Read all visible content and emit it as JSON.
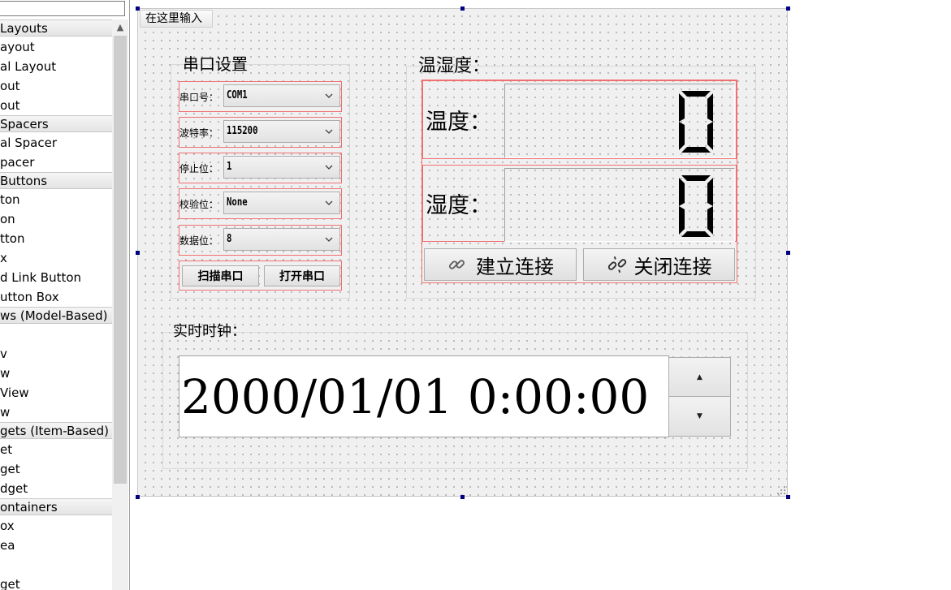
{
  "widget_box": {
    "filter_value": "",
    "rows": [
      {
        "kind": "cat",
        "text": "Layouts",
        "indent": 0
      },
      {
        "kind": "item",
        "text": "ayout",
        "indent": 0
      },
      {
        "kind": "item",
        "text": "al Layout",
        "indent": 0
      },
      {
        "kind": "item",
        "text": "out",
        "indent": 0
      },
      {
        "kind": "item",
        "text": "out",
        "indent": 0
      },
      {
        "kind": "cat",
        "text": "Spacers",
        "indent": 0
      },
      {
        "kind": "item",
        "text": "al Spacer",
        "indent": 0
      },
      {
        "kind": "item",
        "text": "pacer",
        "indent": 0
      },
      {
        "kind": "cat",
        "text": "Buttons",
        "indent": 0
      },
      {
        "kind": "item",
        "text": "ton",
        "indent": 0
      },
      {
        "kind": "item",
        "text": "on",
        "indent": 0
      },
      {
        "kind": "item",
        "text": "tton",
        "indent": 0
      },
      {
        "kind": "item",
        "text": "x",
        "indent": 0
      },
      {
        "kind": "item",
        "text": "d Link Button",
        "indent": 0
      },
      {
        "kind": "item",
        "text": "utton Box",
        "indent": 0
      },
      {
        "kind": "cat",
        "text": "ws (Model-Based)",
        "indent": 0
      },
      {
        "kind": "item",
        "text": "",
        "indent": 0
      },
      {
        "kind": "item",
        "text": "v",
        "indent": 0
      },
      {
        "kind": "item",
        "text": "w",
        "indent": 0
      },
      {
        "kind": "item",
        "text": "View",
        "indent": 0
      },
      {
        "kind": "item",
        "text": "w",
        "indent": 0
      },
      {
        "kind": "cat",
        "text": "gets (Item-Based)",
        "indent": 0
      },
      {
        "kind": "item",
        "text": "et",
        "indent": 0
      },
      {
        "kind": "item",
        "text": "get",
        "indent": 0
      },
      {
        "kind": "item",
        "text": "dget",
        "indent": 0
      },
      {
        "kind": "cat",
        "text": "ontainers",
        "indent": 0
      },
      {
        "kind": "item",
        "text": "ox",
        "indent": 0
      },
      {
        "kind": "item",
        "text": "ea",
        "indent": 0
      },
      {
        "kind": "item",
        "text": "",
        "indent": 0
      },
      {
        "kind": "item",
        "text": "get",
        "indent": 0
      }
    ]
  },
  "form": {
    "menu_placeholder": "在这里输入",
    "serial": {
      "title": "串口设置",
      "port_label": "串口号：",
      "port_value": "COM1",
      "baud_label": "波特率：",
      "baud_value": "115200",
      "stop_label": "停止位：",
      "stop_value": "1",
      "parity_label": "校验位：",
      "parity_value": "None",
      "data_label": "数据位：",
      "data_value": "8",
      "scan_button": "扫描串口",
      "open_button": "打开串口"
    },
    "sensor": {
      "title": "温湿度：",
      "temp_label": "温度：",
      "temp_value": "0",
      "humi_label": "湿度：",
      "humi_value": "0",
      "connect_button": "建立连接",
      "disconnect_button": "关闭连接"
    },
    "clock": {
      "title": "实时时钟：",
      "datetime": "2000/01/01  0:00:00"
    }
  },
  "colors": {
    "selection_handle": "#000080",
    "layout_border": "#f07070"
  }
}
